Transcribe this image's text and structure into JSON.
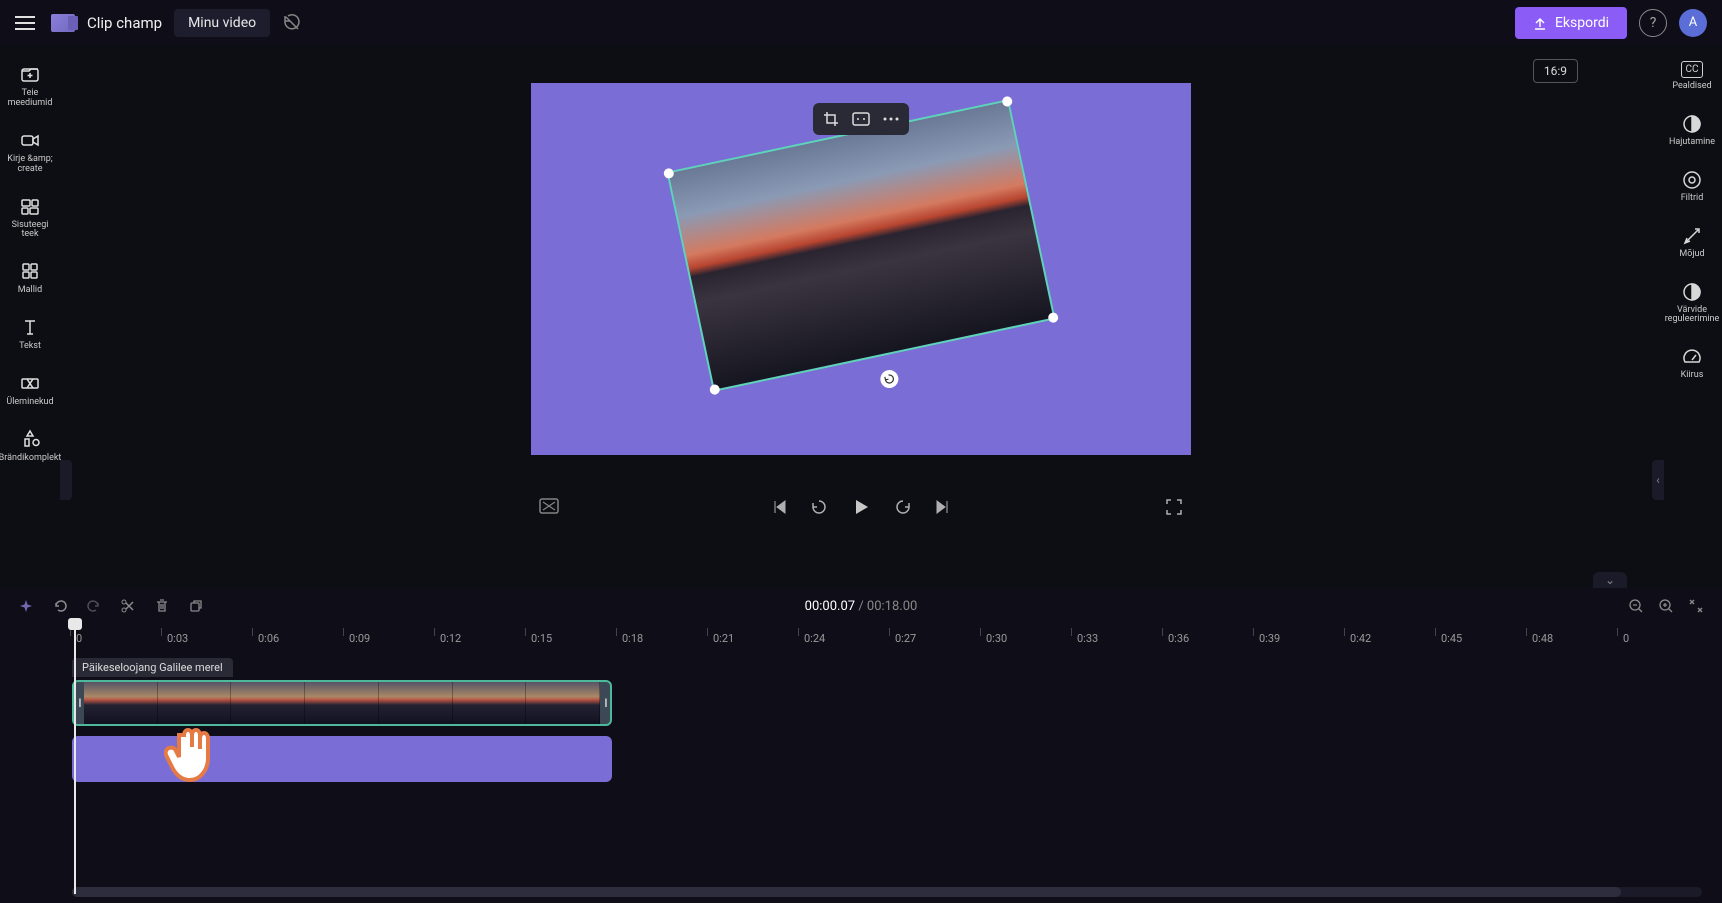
{
  "header": {
    "app_name": "Clip champ",
    "project_name": "Minu video",
    "export_label": "Ekspordi",
    "avatar_letter": "A"
  },
  "left_sidebar": [
    {
      "label": "Teie meediumid"
    },
    {
      "label": "Kirje &amp;\ncreate"
    },
    {
      "label": "Sisuteegi\nteek"
    },
    {
      "label": "Mallid"
    },
    {
      "label": "Tekst"
    },
    {
      "label": "Üleminekud"
    },
    {
      "label": "Brändikomplekt"
    }
  ],
  "preview": {
    "aspect_ratio": "16:9"
  },
  "right_sidebar": [
    {
      "label": "Pealdised"
    },
    {
      "label": "Hajutamine"
    },
    {
      "label": "Filtrid"
    },
    {
      "label": "Mõjud"
    },
    {
      "label": "Värvide\nreguleerimine"
    },
    {
      "label": "Kiirus"
    }
  ],
  "timeline": {
    "current_time": "00:00.07",
    "total_time": "00:18.00",
    "ruler": [
      "0",
      "0:03",
      "0:06",
      "0:09",
      "0:12",
      "0:15",
      "0:18",
      "0:21",
      "0:24",
      "0:27",
      "0:30",
      "0:33",
      "0:36",
      "0:39",
      "0:42",
      "0:45",
      "0:48",
      "0"
    ],
    "clip_title": "Päikeseloojang Galilee merel"
  }
}
